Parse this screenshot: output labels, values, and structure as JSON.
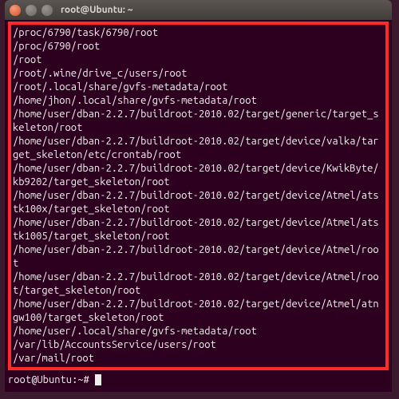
{
  "window": {
    "title": "root@Ubuntu: ~"
  },
  "terminal": {
    "lines": [
      "/proc/6790/task/6790/root",
      "/proc/6790/root",
      "/root",
      "/root/.wine/drive_c/users/root",
      "/root/.local/share/gvfs-metadata/root",
      "/home/jhon/.local/share/gvfs-metadata/root",
      "/home/user/dban-2.2.7/buildroot-2010.02/target/generic/target_skeleton/root",
      "/home/user/dban-2.2.7/buildroot-2010.02/target/device/valka/target_skeleton/etc/crontab/root",
      "/home/user/dban-2.2.7/buildroot-2010.02/target/device/KwikByte/kb9202/target_skeleton/root",
      "/home/user/dban-2.2.7/buildroot-2010.02/target/device/Atmel/atstk100x/target_skeleton/root",
      "/home/user/dban-2.2.7/buildroot-2010.02/target/device/Atmel/atstk1005/target_skeleton/root",
      "/home/user/dban-2.2.7/buildroot-2010.02/target/device/Atmel/root",
      "/home/user/dban-2.2.7/buildroot-2010.02/target/device/Atmel/root/target_skeleton/root",
      "/home/user/dban-2.2.7/buildroot-2010.02/target/device/Atmel/atngw100/target_skeleton/root",
      "/home/user/.local/share/gvfs-metadata/root",
      "/var/lib/AccountsService/users/root",
      "/var/mail/root"
    ],
    "prompt": "root@Ubuntu:~# "
  },
  "colors": {
    "terminal_bg": "#2c001e",
    "terminal_fg": "#eeeeec",
    "highlight_border": "#ff2a2a"
  }
}
